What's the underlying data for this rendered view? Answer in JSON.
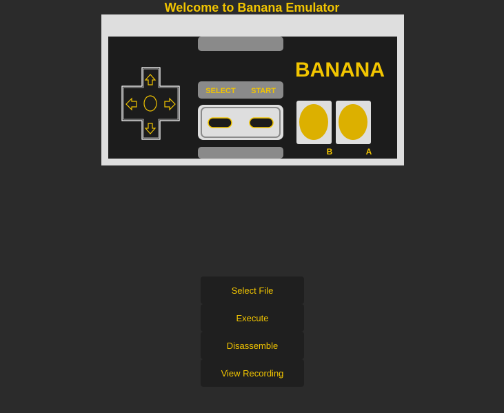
{
  "header": {
    "title": "Welcome to Banana Emulator"
  },
  "controller": {
    "brand_label": "BANANA",
    "select_label": "SELECT",
    "start_label": "START",
    "b_label": "B",
    "a_label": "A",
    "colors": {
      "accent": "#f2c500",
      "frame": "#dedede",
      "body": "#1c1c1c",
      "grey_panel": "#8a8a8a",
      "face_button": "#dcb000"
    }
  },
  "menu": {
    "select_file_label": "Select File",
    "execute_label": "Execute",
    "disassemble_label": "Disassemble",
    "view_recording_label": "View Recording"
  },
  "theme": {
    "background": "#2b2b2b",
    "button_bg": "#1f1f1f",
    "accent": "#f2c500"
  }
}
